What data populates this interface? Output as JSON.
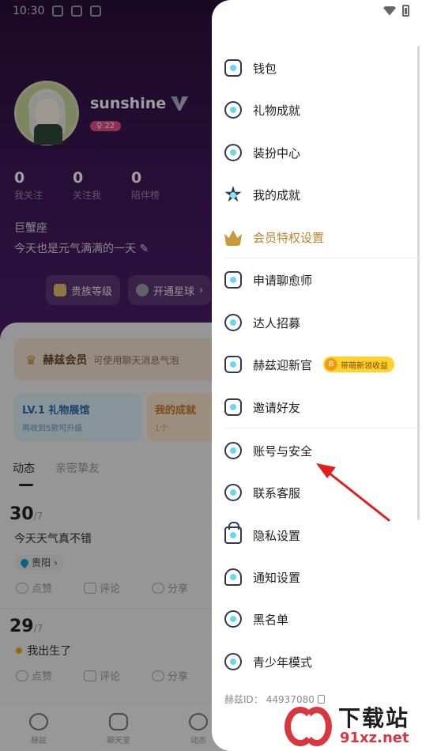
{
  "status_bar": {
    "time": "10:30"
  },
  "profile": {
    "username": "sunshine",
    "level": "22",
    "stats": [
      {
        "num": "0",
        "label": "我关注"
      },
      {
        "num": "0",
        "label": "关注我"
      },
      {
        "num": "0",
        "label": "陪伴榜"
      }
    ],
    "zodiac": "巨蟹座",
    "bio": "今天也是元气满满的一天",
    "buttons": [
      "贵族等级",
      "开通星球"
    ]
  },
  "cards": {
    "vip_title": "赫兹会员",
    "vip_subtitle": "可使用聊天消息气泡",
    "gift_title": "LV.1 礼物展馆",
    "gift_sub": "再收到5款可升级",
    "ach_title": "我的成就",
    "ach_sub": "1个"
  },
  "feed_tabs": [
    "动态",
    "亲密挚友"
  ],
  "posts": [
    {
      "day": "30",
      "month": "/7",
      "text": "今天天气真不错",
      "location": "贵阳"
    },
    {
      "day": "29",
      "month": "/7",
      "text": "我出生了"
    }
  ],
  "post_actions": {
    "like": "点赞",
    "comment": "评论",
    "share": "分享"
  },
  "bottom_nav": [
    "赫兹",
    "聊天室",
    "动态"
  ],
  "drawer": {
    "items_group1": [
      {
        "label": "钱包",
        "icon": "wallet-icon"
      },
      {
        "label": "礼物成就",
        "icon": "gift-achievement-icon"
      },
      {
        "label": "装扮中心",
        "icon": "dress-up-icon"
      },
      {
        "label": "我的成就",
        "icon": "star-icon"
      },
      {
        "label": "会员特权设置",
        "icon": "crown-icon"
      }
    ],
    "items_group2": [
      {
        "label": "申请聊愈师",
        "icon": "heart-chat-icon"
      },
      {
        "label": "达人招募",
        "icon": "badge-icon"
      },
      {
        "label": "赫兹迎新官",
        "icon": "id-card-icon"
      },
      {
        "label": "邀请好友",
        "icon": "invite-icon"
      }
    ],
    "items_group3": [
      {
        "label": "账号与安全",
        "icon": "account-security-icon"
      },
      {
        "label": "联系客服",
        "icon": "headset-icon"
      },
      {
        "label": "隐私设置",
        "icon": "lock-icon"
      },
      {
        "label": "通知设置",
        "icon": "bell-icon"
      },
      {
        "label": "黑名单",
        "icon": "blacklist-icon"
      },
      {
        "label": "青少年模式",
        "icon": "teen-mode-icon"
      }
    ],
    "promo_badge": "带萌新领收益",
    "promo_coin": "B",
    "user_id_label": "赫兹ID：",
    "user_id": "44937080"
  },
  "watermark": {
    "big": "下载站",
    "small": "91xz.net"
  },
  "colors": {
    "accent_gold": "#b8862b",
    "arrow_red": "#e02020",
    "promo_yellow": "#ffd12a"
  }
}
